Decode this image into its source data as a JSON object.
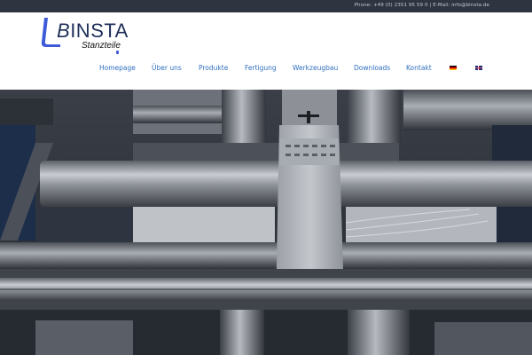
{
  "topbar": {
    "contact": "Phone: +49 (0) 2351 95 59 0 | E-Mail: info@binsta.de"
  },
  "logo": {
    "name_part1": "B",
    "name_part2": "INSTA",
    "tagline": "Stanzteile"
  },
  "nav": {
    "items": [
      {
        "label": "Homepage"
      },
      {
        "label": "Über uns"
      },
      {
        "label": "Produkte"
      },
      {
        "label": "Fertigung"
      },
      {
        "label": "Werkzeugbau"
      },
      {
        "label": "Downloads"
      },
      {
        "label": "Kontakt"
      }
    ],
    "languages": [
      {
        "code": "de",
        "icon": "german-flag-icon"
      },
      {
        "code": "en",
        "icon": "british-flag-icon"
      }
    ]
  },
  "colors": {
    "topbar": "#2e3440",
    "nav_link": "#2f6fbe",
    "logo_blue": "#3d5bd9",
    "logo_text": "#1f2f59"
  },
  "hero": {
    "subject": "stamping-press-machinery-photo"
  }
}
